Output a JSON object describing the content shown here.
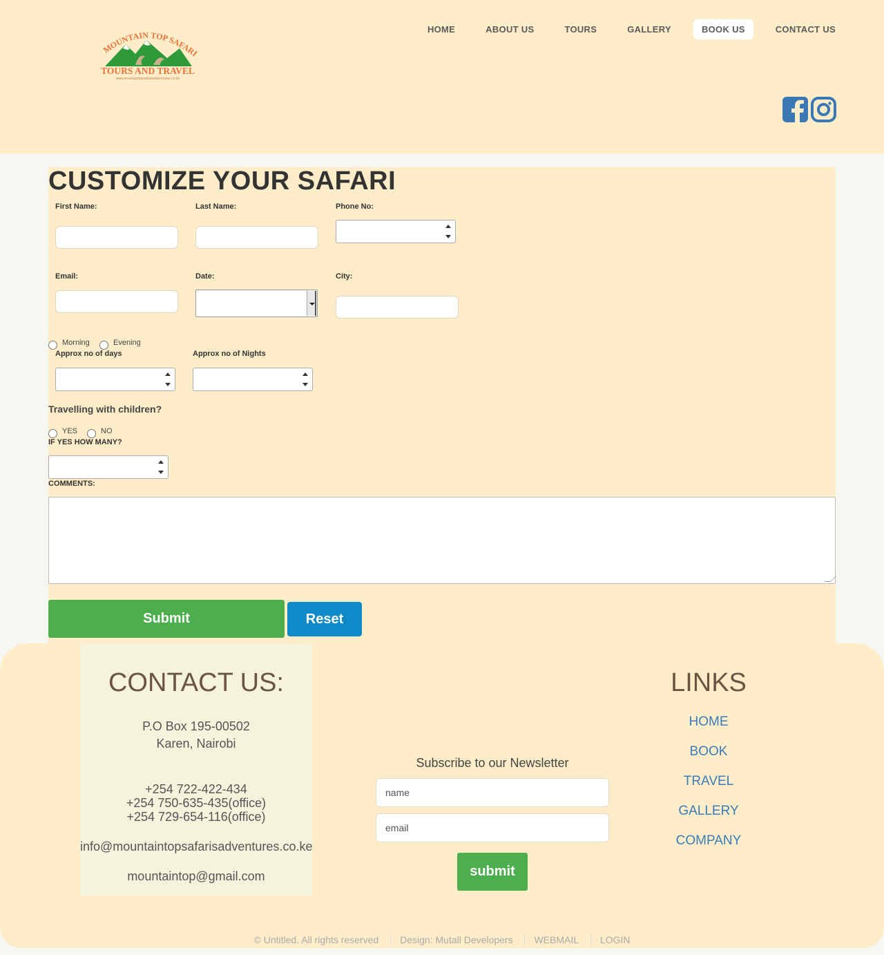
{
  "header": {
    "logo": {
      "top_text": "MOUNTAIN TOP SAFARIS",
      "bottom_text": "TOURS AND TRAVEL",
      "url_text": "www.mountaintopsafarisadventures.co.ke"
    },
    "nav": [
      "HOME",
      "ABOUT US",
      "TOURS",
      "GALLERY",
      "BOOK US",
      "CONTACT US"
    ],
    "active_nav": "BOOK US",
    "social": [
      "facebook-icon",
      "instagram-icon"
    ]
  },
  "form": {
    "title": "CUSTOMIZE YOUR SAFARI",
    "first_name_label": "First Name:",
    "last_name_label": "Last Name:",
    "phone_label": "Phone No:",
    "email_label": "Email:",
    "date_label": "Date:",
    "city_label": "City:",
    "morning_label": "Morning",
    "evening_label": "Evening",
    "days_label": "Approx no of days",
    "nights_label": "Approx no of Nights",
    "children_question": "Travelling with children?",
    "yes_label": "YES",
    "no_label": "NO",
    "how_many_label": "IF YES HOW MANY?",
    "comments_label": "COMMENTS:",
    "submit_label": "Submit",
    "reset_label": "Reset"
  },
  "footer": {
    "contact_title": "CONTACT US:",
    "address_line1": "P.O Box 195-00502",
    "address_line2": "Karen, Nairobi",
    "phone1": "+254 722-422-434",
    "phone2": "+254 750-635-435(office)",
    "phone3": "+254 729-654-116(office)",
    "email1": "info@mountaintopsafarisadventures.co.ke",
    "email2": "mountaintop@gmail.com",
    "newsletter_title": "Subscribe to our Newsletter",
    "name_placeholder": "name",
    "email_placeholder": "email",
    "newsletter_submit": "submit",
    "links_title": "LINKS",
    "links": [
      "HOME",
      "BOOK",
      "TRAVEL",
      "GALLERY",
      "COMPANY"
    ],
    "bottom": {
      "copyright": "© Untitled. All rights reserved",
      "design": "Design: Mutall Developers",
      "webmail": "WEBMAIL",
      "login": "LOGIN"
    }
  },
  "colors": {
    "panel_bg": "#feedc8",
    "green": "#4cae4c",
    "blue": "#0e8ac8",
    "link_blue": "#3a7bb8",
    "social_blue": "#3a78b5"
  }
}
